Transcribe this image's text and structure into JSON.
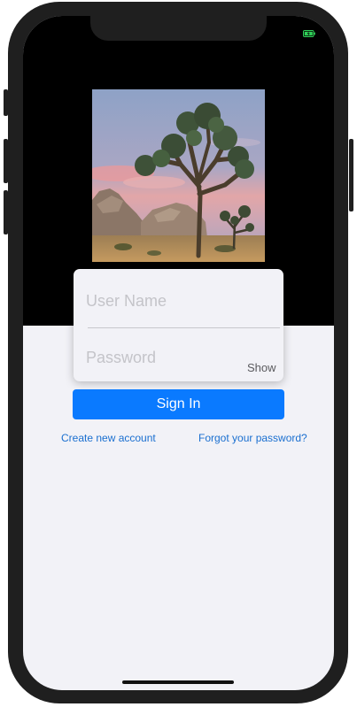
{
  "status_bar": {
    "battery_icon": "battery-charging-icon",
    "battery_color": "#30d158"
  },
  "hero_image": {
    "description_icon": "joshua-tree-photo"
  },
  "login_form": {
    "username": {
      "value": "",
      "placeholder": "User Name"
    },
    "password": {
      "value": "",
      "placeholder": "Password"
    },
    "show_label": "Show"
  },
  "actions": {
    "sign_in_label": "Sign In",
    "create_account_label": "Create new account",
    "forgot_password_label": "Forgot your password?"
  },
  "colors": {
    "accent": "#0a7aff",
    "link": "#1a6fd0",
    "background": "#f2f2f7"
  }
}
